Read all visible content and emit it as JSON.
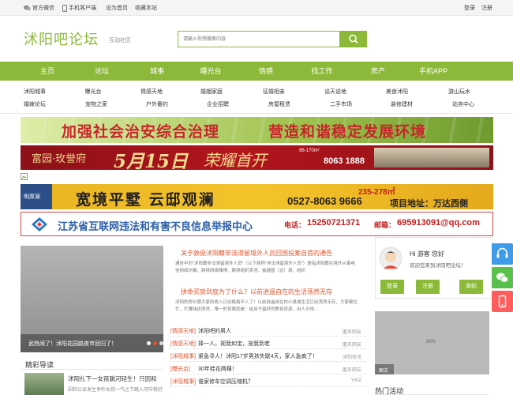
{
  "topbar": {
    "wechat_label": "官方微信",
    "mobile_label": "手机客户端",
    "homepage_label": "设为首页",
    "favorite_label": "收藏本站",
    "login_label": "登录",
    "register_label": "注册"
  },
  "header": {
    "logo_text": "沭阳吧论坛",
    "logo_sub": "互动社区",
    "search_placeholder": "请输入你想搜索内容"
  },
  "nav": {
    "items": [
      "主页",
      "论坛",
      "城事",
      "曝光台",
      "情感",
      "找工作",
      "房产",
      "手机APP"
    ]
  },
  "subnav": {
    "row1": [
      "沭阳城事",
      "曝光台",
      "情感天地",
      "婚姻家庭",
      "征婚相亲",
      "谈天说地",
      "美食沭阳",
      "游山玩水"
    ],
    "row2": [
      "婚嫁论坛",
      "宠物之家",
      "户外番钓",
      "企业招聘",
      "房屋租赁",
      "二手市场",
      "装修建材",
      "站务中心"
    ]
  },
  "banners": {
    "b1_main": "加强社会治安综合治理",
    "b1_right": "营造和谐稳定发展环境",
    "b2_left": "富园·玫誉府",
    "b2_date": "5月15日",
    "b2_slogan": "荣耀首开",
    "b2_size": "96-170m²",
    "b2_phone": "8063 1888",
    "b3_brand": "明厚源",
    "b3_main": "宽境平墅 云邸观澜",
    "b3_area": "235-278㎡",
    "b3_phone": "0527-8063 9666",
    "b3_location": "项目地址：万达西侧",
    "b4_main": "江苏省互联网违法和有害不良信息举报中心",
    "b4_phone_label": "电话：",
    "b4_phone": "15250721371",
    "b4_email_label": "邮箱：",
    "b4_email": "695913091@qq.com"
  },
  "slider": {
    "caption": "武热闹了！沭阳花园路夜市回归了！"
  },
  "featured": {
    "headline1": "关于敦促沭阳籍非法滞留境外人员回国投案自首的通告",
    "text1": "通告中的\"沭阳籍非法滞留境外人员\"（以下简称\"非法滞留境外人员\"）是指沭阳籍在境外从事电信网络诈骗、跨境网络赌博、跨境组织卖淫、偷越国（边）境、组织",
    "headline2": "拼命买房到底为了什么？以前逍遥自在的生活荡然无存",
    "text2": "沭阳的房价跟大家的收入已经格格不入了！以前逍遥自在的小县城生活已经荡然无存，大家都在忙，忙赚钱还房贷，唯一的答案就是：给孩子最好的教育资源，出人头地..."
  },
  "news": [
    {
      "cat": "[情感天地]",
      "title": "沭阳吧的男人",
      "author": "匿名网友"
    },
    {
      "cat": "[情感天地]",
      "title": "择一人，视我如宝，宠我到老",
      "author": "匿名网友"
    },
    {
      "cat": "[沭阳城事]",
      "title": "紧急寻人！沭阳17岁男孩失联4天，家人急疯了！",
      "author": "沭阳快讯"
    },
    {
      "cat": "[曝光台]",
      "title": "30年桂花两棵！",
      "author": "匿名网友"
    },
    {
      "cat": "[沭阳城事]",
      "title": "谁家修车空调压缩机？",
      "author": "YWZ"
    }
  ],
  "jingcai": {
    "title": "精彩导读",
    "item_title": "沭阳扎下一女孩跳河轻生！只因和",
    "item_text": "因和父亲发生争吵女孩一气之下跳入河中救好"
  },
  "user": {
    "greeting": "Hi 游客 您好",
    "welcome": "欢迎您来到沭阳吧论坛！",
    "login_btn": "登录",
    "register_btn": "注册",
    "post_btn": "发帖"
  },
  "right_ad": {
    "percent_label": "80%",
    "caption": "图文"
  },
  "hot": {
    "title": "热门活动"
  },
  "colors": {
    "brand_green": "#8cb93a",
    "accent_orange": "#e0542b",
    "side_blue": "#3d9be9",
    "side_green": "#59c14b",
    "side_red": "#ff5c5c"
  }
}
